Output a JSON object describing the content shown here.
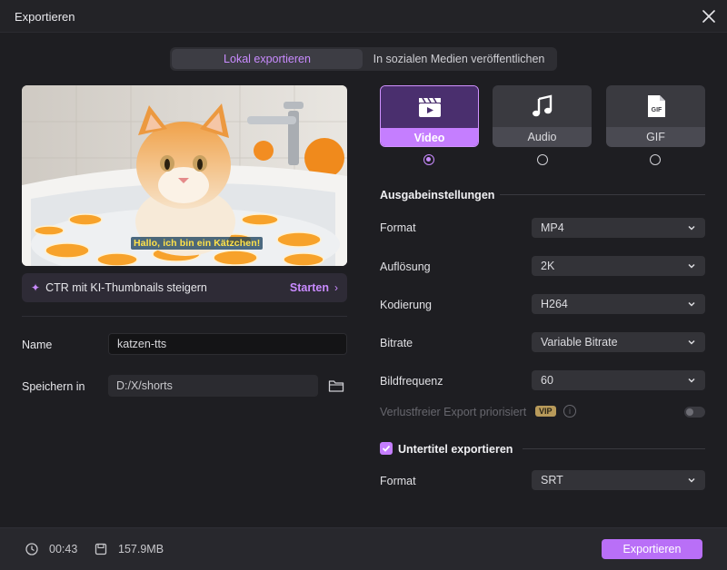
{
  "window": {
    "title": "Exportieren"
  },
  "tabs": [
    {
      "label": "Lokal exportieren",
      "active": true
    },
    {
      "label": "In sozialen Medien veröffentlichen",
      "active": false
    }
  ],
  "preview": {
    "caption": "Hallo, ich bin ein Kätzchen!"
  },
  "ctr_banner": {
    "label": "CTR mit KI-Thumbnails steigern",
    "action": "Starten"
  },
  "fields": {
    "name_label": "Name",
    "name_value": "katzen-tts",
    "save_label": "Speichern in",
    "save_path": "D:/X/shorts"
  },
  "types": [
    {
      "label": "Video",
      "icon": "video-clapper-icon",
      "selected": true
    },
    {
      "label": "Audio",
      "icon": "music-note-icon",
      "selected": false
    },
    {
      "label": "GIF",
      "icon": "gif-file-icon",
      "selected": false
    }
  ],
  "output_settings": {
    "title": "Ausgabeinstellungen",
    "rows": [
      {
        "label": "Format",
        "value": "MP4"
      },
      {
        "label": "Auflösung",
        "value": "2K"
      },
      {
        "label": "Kodierung",
        "value": "H264"
      },
      {
        "label": "Bitrate",
        "value": "Variable Bitrate"
      },
      {
        "label": "Bildfrequenz",
        "value": "60"
      }
    ],
    "lossless_label": "Verlustfreier Export priorisiert",
    "vip_badge": "VIP",
    "lossless_enabled": false
  },
  "subtitles": {
    "label": "Untertitel exportieren",
    "checked": true,
    "format_label": "Format",
    "format_value": "SRT"
  },
  "footer": {
    "duration": "00:43",
    "size": "157.9MB",
    "export_label": "Exportieren"
  },
  "colors": {
    "accent": "#c57eff",
    "background": "#1e1e22",
    "footer": "#28282d"
  }
}
